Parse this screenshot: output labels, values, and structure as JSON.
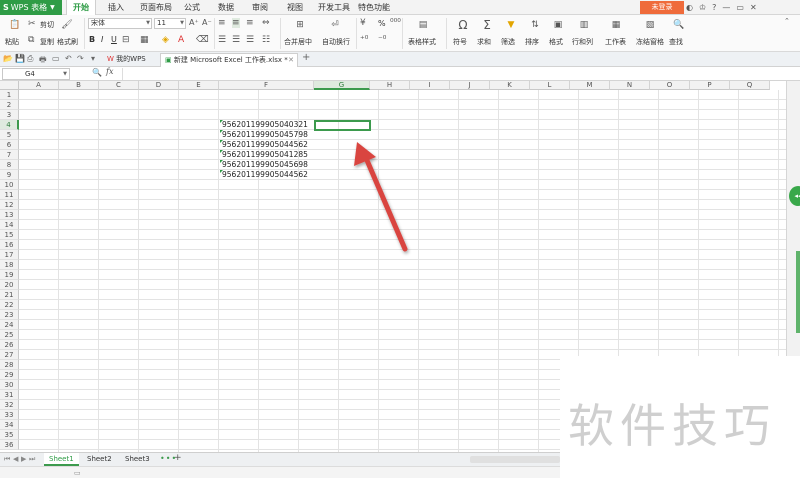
{
  "app": {
    "logo_text": "WPS 表格",
    "login_label": "未登录"
  },
  "menu": [
    "开始",
    "插入",
    "页面布局",
    "公式",
    "数据",
    "审阅",
    "视图",
    "开发工具",
    "特色功能"
  ],
  "ribbon": {
    "paste": "粘贴",
    "cut": "剪切",
    "copy": "复制",
    "format_painter": "格式刷",
    "font_name": "宋体",
    "font_size": "11",
    "bold": "B",
    "italic": "I",
    "underline": "U",
    "merge_center": "合并居中",
    "wrap_text": "自动换行",
    "percent": "%",
    "table_style": "表格样式",
    "symbol": "符号",
    "sum": "求和",
    "filter": "筛选",
    "sort": "排序",
    "format": "格式",
    "row_col": "行和列",
    "worksheet": "工作表",
    "freeze": "冻结窗格",
    "find": "查找"
  },
  "tabs": {
    "home": "我的WPS",
    "document": "新建 Microsoft Excel 工作表.xlsx *"
  },
  "formula_bar": {
    "name_box": "G4",
    "fx": "fx",
    "formula": ""
  },
  "grid": {
    "columns": [
      "A",
      "B",
      "C",
      "D",
      "E",
      "F",
      "G",
      "H",
      "I",
      "J",
      "K",
      "L",
      "M",
      "N",
      "O",
      "P",
      "Q"
    ],
    "rows": [
      "1",
      "2",
      "3",
      "4",
      "5",
      "6",
      "7",
      "8",
      "9",
      "10",
      "11",
      "12",
      "13",
      "14",
      "15",
      "16",
      "17",
      "18",
      "19",
      "20",
      "21",
      "22",
      "23",
      "24",
      "25",
      "26",
      "27",
      "28",
      "29",
      "30",
      "31",
      "32",
      "33",
      "34",
      "35",
      "36"
    ],
    "selected_cell": "G4",
    "f_column_values": [
      {
        "row": "4",
        "value": "956201199905040321"
      },
      {
        "row": "5",
        "value": "956201199905045798"
      },
      {
        "row": "6",
        "value": "956201199905044562"
      },
      {
        "row": "7",
        "value": "956201199905041285"
      },
      {
        "row": "8",
        "value": "956201199905045698"
      },
      {
        "row": "9",
        "value": "956201199905044562"
      }
    ]
  },
  "sheets": {
    "tabs": [
      "Sheet1",
      "Sheet2",
      "Sheet3"
    ],
    "active": "Sheet1",
    "more": "•••",
    "add": "+"
  },
  "watermark": "软件技巧",
  "colors": {
    "brand_green": "#2f9c46",
    "selection_green": "#3c9a4d",
    "login_orange": "#ef6b3b",
    "arrow_red": "#d9453f"
  }
}
